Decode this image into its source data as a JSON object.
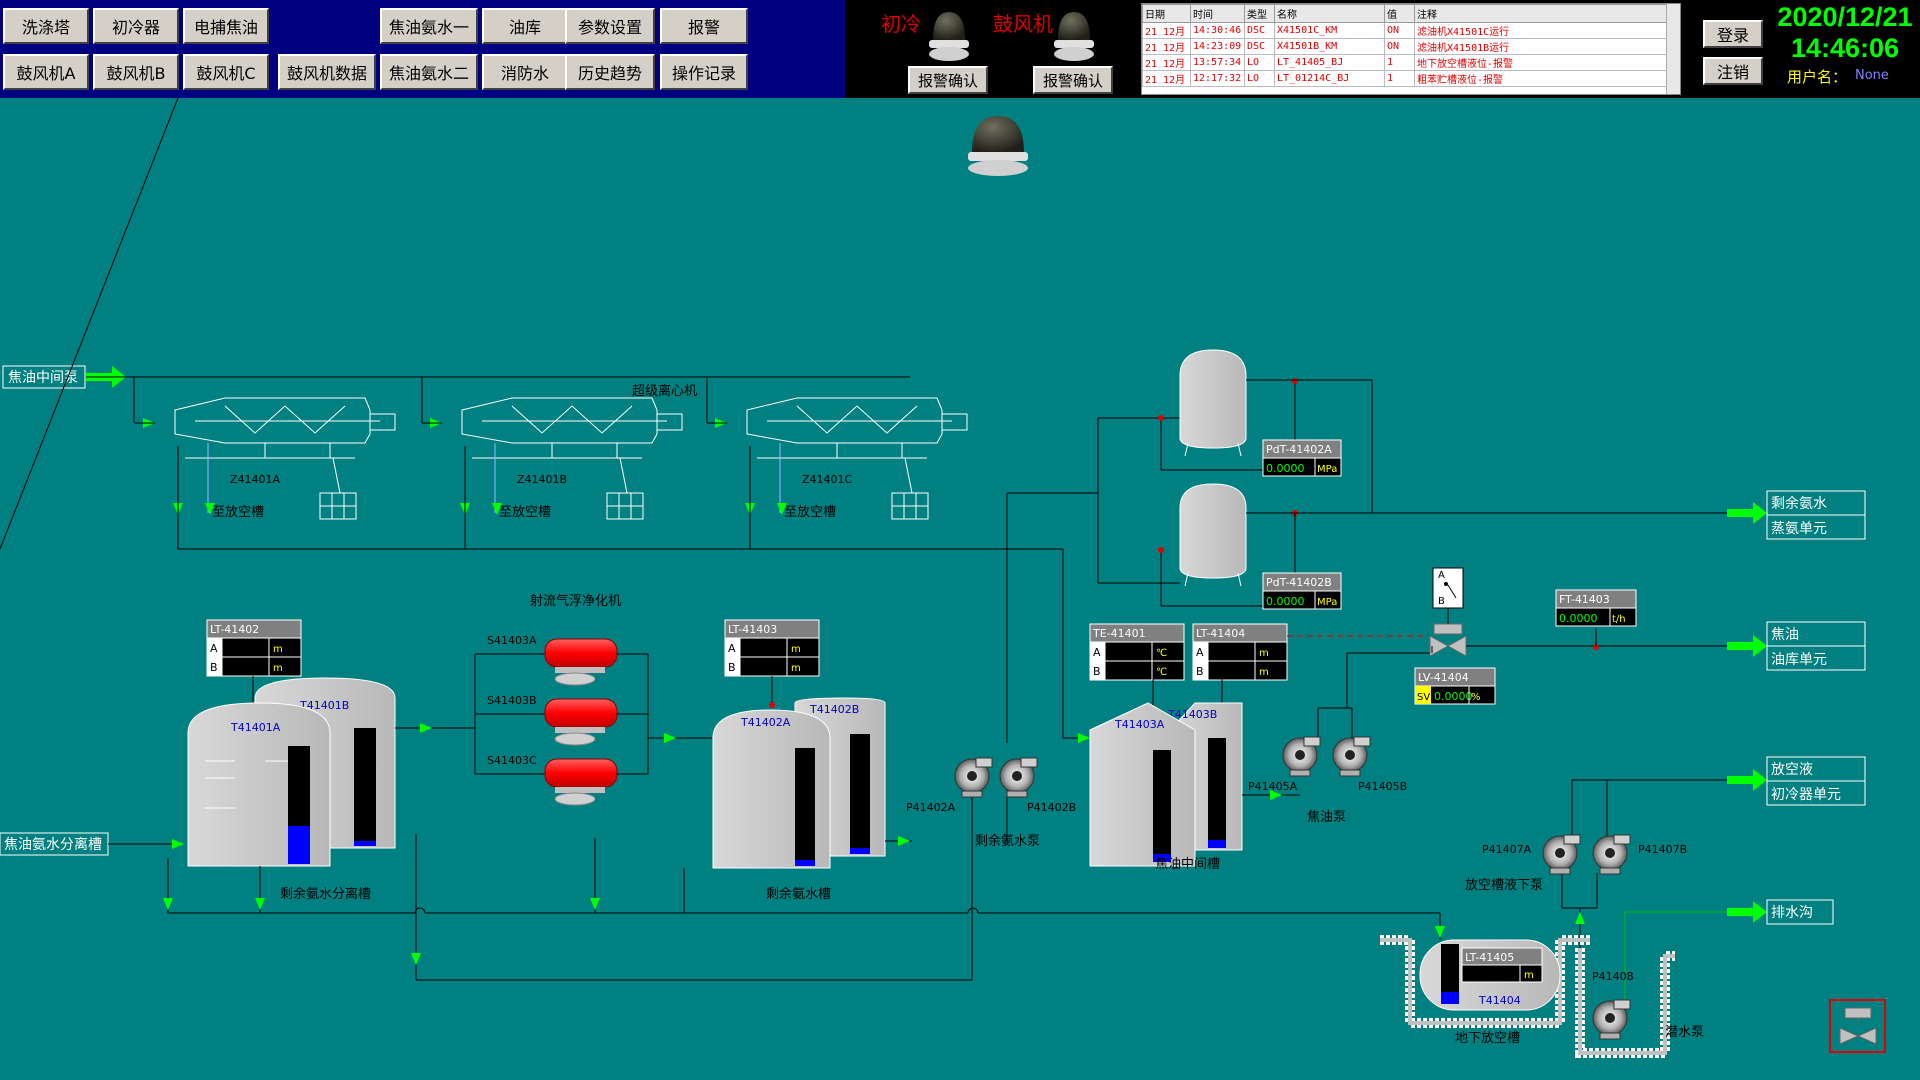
{
  "nav": {
    "row1": [
      "洗涤塔",
      "初冷器",
      "电捕焦油",
      "焦油氨水一",
      "油库",
      "参数设置",
      "报警"
    ],
    "row2": [
      "鼓风机A",
      "鼓风机B",
      "鼓风机C",
      "鼓风机数据",
      "焦油氨水二",
      "消防水",
      "历史趋势",
      "操作记录"
    ]
  },
  "alarm": {
    "lamp1_label": "初冷",
    "lamp2_label": "鼓风机",
    "ack1": "报警确认",
    "ack2": "报警确认",
    "headers": [
      "日期",
      "时间",
      "类型",
      "名称",
      "值",
      "注释"
    ],
    "rows": [
      [
        "21 12月",
        "14:30:46",
        "DSC",
        "X41501C_KM",
        "ON",
        "滤油机X41501C运行"
      ],
      [
        "21 12月",
        "14:23:09",
        "DSC",
        "X41501B_KM",
        "ON",
        "滤油机X41501B运行"
      ],
      [
        "21 12月",
        "13:57:34",
        "LO",
        "LT_41405_BJ",
        "1",
        "地下放空槽液位-报警"
      ],
      [
        "21 12月",
        "12:17:32",
        "LO",
        "LT_01214C_BJ",
        "1",
        "粗苯贮槽液位-报警"
      ]
    ]
  },
  "session": {
    "login": "登录",
    "logout": "注销",
    "date": "2020/12/21",
    "time": "14:46:06",
    "user_label": "用户名：",
    "user_value": "None"
  },
  "process": {
    "feed_in": "焦油中间泵",
    "separator_in": "焦油氨水分离槽",
    "centrifuge_title": "超级离心机",
    "centrifuges": [
      "Z41401A",
      "Z41401B",
      "Z41401C"
    ],
    "vent": "至放空槽",
    "jet_title": "射流气浮净化机",
    "jets": [
      "S41403A",
      "S41403B",
      "S41403C"
    ],
    "sep_tanks": [
      "T41401A",
      "T41401B"
    ],
    "sep_tank_name": "剩余氨水分离槽",
    "ammonia_tanks": [
      "T41402A",
      "T41402B"
    ],
    "ammonia_tank_name": "剩余氨水槽",
    "ammonia_pumps": [
      "P41402A",
      "P41402B"
    ],
    "ammonia_pump_name": "剩余氨水泵",
    "tar_tanks": [
      "T41403A",
      "T41403B"
    ],
    "tar_tank_name": "焦油中间槽",
    "tar_pumps": [
      "P41405A",
      "P41405B"
    ],
    "tar_pump_name": "焦油泵",
    "vent_pumps": [
      "P41407A",
      "P41407B"
    ],
    "vent_pump_name": "放空槽液下泵",
    "sump_pump": "P41408",
    "sump_pump_name": "潜水泵",
    "under_tank": "T41404",
    "under_tank_name": "地下放空槽",
    "valve_labels": [
      "A",
      "B"
    ]
  },
  "instruments": {
    "lt41402": {
      "tag": "LT-41402",
      "rows": [
        "A",
        "B"
      ],
      "unit": "m"
    },
    "lt41403": {
      "tag": "LT-41403",
      "rows": [
        "A",
        "B"
      ],
      "unit": "m"
    },
    "te41401": {
      "tag": "TE-41401",
      "rows": [
        "A",
        "B"
      ],
      "unit": "℃"
    },
    "lt41404": {
      "tag": "LT-41404",
      "rows": [
        "A",
        "B"
      ],
      "unit": "m"
    },
    "pdt41402a": {
      "tag": "PdT-41402A",
      "value": "0.0000",
      "unit": "MPa"
    },
    "pdt41402b": {
      "tag": "PdT-41402B",
      "value": "0.0000",
      "unit": "MPa"
    },
    "ft41403": {
      "tag": "FT-41403",
      "value": "0.0000",
      "unit": "t/h"
    },
    "lv41404": {
      "tag": "LV-41404",
      "prefix": "SV",
      "value": "0.0000",
      "unit": "%"
    },
    "lt41405": {
      "tag": "LT-41405",
      "unit": "m"
    }
  },
  "outputs": {
    "ammonia": [
      "剩余氨水",
      "蒸氨单元"
    ],
    "tar": [
      "焦油",
      "油库单元"
    ],
    "vent": [
      "放空液",
      "初冷器单元"
    ],
    "drain": "排水沟"
  },
  "levels": {
    "T41401A": 0.32,
    "T41401B": 0.04,
    "T41402A": 0.05,
    "T41402B": 0.05,
    "T41403A": 0.07,
    "T41403B": 0.07,
    "T41404": 0.2
  },
  "colors": {
    "background": "#008080",
    "nav_bar": "#000080",
    "alarm_text": "#e00000",
    "clock": "#00ff00",
    "level_fill": "#0000ff",
    "jet_body": "#ff0000",
    "flow_arrow": "#00ff00"
  }
}
